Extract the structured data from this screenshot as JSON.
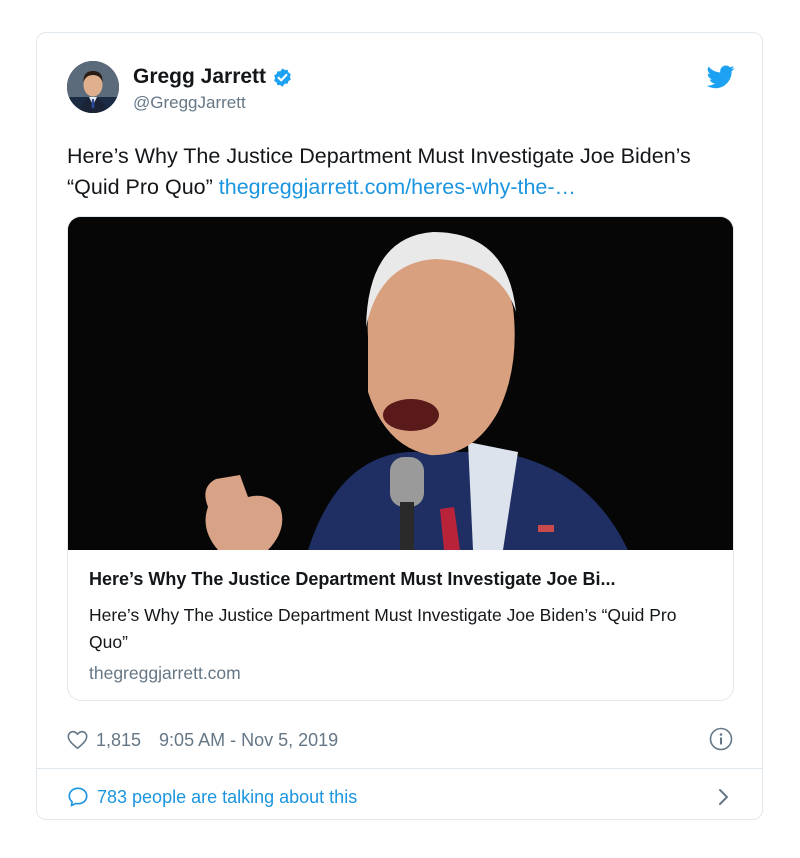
{
  "author": {
    "display_name": "Gregg Jarrett",
    "handle": "@GreggJarrett",
    "verified": true
  },
  "tweet": {
    "text": "Here’s Why The Justice Department Must Investigate Joe Biden’s “Quid Pro Quo”",
    "link_text": "thegreggjarrett.com/heres-why-the-…"
  },
  "card": {
    "title": "Here’s Why The Justice Department Must Investigate Joe Bi...",
    "description": "Here’s Why The Justice Department Must Investigate Joe Biden’s “Quid Pro Quo”",
    "domain": "thegreggjarrett.com"
  },
  "meta": {
    "likes": "1,815",
    "timestamp": "9:05 AM - Nov 5, 2019"
  },
  "conversation": {
    "label": "783 people are talking about this"
  },
  "icons": {
    "verified": "verified-badge-icon",
    "platform": "twitter-bird-icon",
    "like": "heart-icon",
    "info": "info-icon",
    "reply": "speech-bubble-icon",
    "chevron": "chevron-right-icon"
  },
  "colors": {
    "link": "#1b95e0",
    "secondary_text": "#657786",
    "border": "#e1e8ed"
  }
}
